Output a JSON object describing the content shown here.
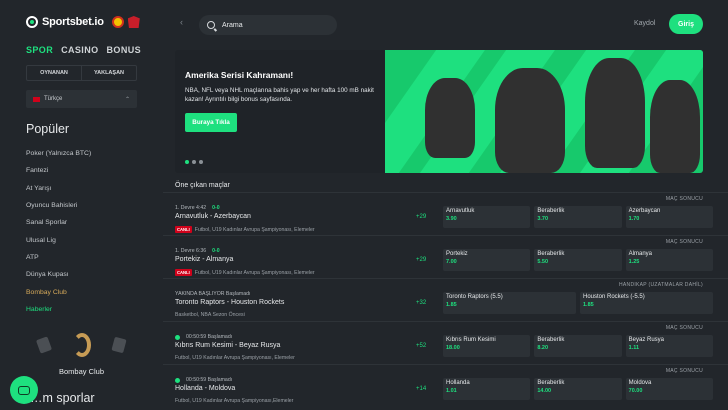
{
  "brand": {
    "name": "Sportsbet.io"
  },
  "sidebar": {
    "modes": [
      "SPOR",
      "CASINO",
      "BONUS"
    ],
    "subtabs": [
      "OYNANAN",
      "YAKLAŞAN"
    ],
    "language": "Türkçe",
    "popular_title": "Popüler",
    "items": [
      "Poker (Yalnızca BTC)",
      "Fantezi",
      "At Yarışı",
      "Oyuncu Bahisleri",
      "Sanal Sporlar",
      "Ulusal Lig",
      "ATP",
      "Dünya Kupası",
      "Bombay Club",
      "Haberler"
    ],
    "club_label": "Bombay Club",
    "bottom_title": "…m sporlar"
  },
  "header": {
    "back_glyph": "‹",
    "search_value": "Arama",
    "register_label": "Kaydol",
    "login_label": "Giriş"
  },
  "banner": {
    "title": "Amerika Serisi Kahramanı!",
    "text": "NBA, NFL veya NHL maçlarına bahis yap ve her hafta 100 mB nakit kazan! Ayrıntılı bilgi bonus sayfasında.",
    "button_label": "Buraya Tıkla"
  },
  "featured_title": "Öne çıkan maçlar",
  "matches": [
    {
      "market_title": "MAÇ SONUCU",
      "status": "1. Devre   4:42",
      "score": "0-0",
      "teams": "Arnavutluk - Azerbaycan",
      "live_tag": "CANLI",
      "league": "Futbol, U19 Kadınlar Avrupa Şampiyonası, Elemeler",
      "count": "+29",
      "odds": [
        {
          "label": "Arnavutluk",
          "value": "3.90"
        },
        {
          "label": "Beraberlik",
          "value": "3.70"
        },
        {
          "label": "Azerbaycan",
          "value": "1.70"
        }
      ]
    },
    {
      "market_title": "MAÇ SONUCU",
      "status": "1. Devre   6:36",
      "score": "0-0",
      "teams": "Portekiz - Almanya",
      "live_tag": "CANLI",
      "league": "Futbol, U19 Kadınlar Avrupa Şampiyonası, Elemeler",
      "count": "+29",
      "odds": [
        {
          "label": "Portekiz",
          "value": "7.00"
        },
        {
          "label": "Beraberlik",
          "value": "5.50"
        },
        {
          "label": "Almanya",
          "value": "1.25"
        }
      ]
    },
    {
      "market_title": "HANDIKAP (UZATMALAR DAHİL)",
      "status": "YAKINDA BAŞLIYOR   Başlamadı",
      "score": "",
      "teams": "Toronto Raptors - Houston Rockets",
      "live_tag": "",
      "league": "Basketbol, NBA Sezon Öncesi",
      "count": "+32",
      "odds": [
        {
          "label": "Toronto Raptors (5.5)",
          "value": "1.85"
        },
        {
          "label": "Houston Rockets (-5.5)",
          "value": "1.85"
        }
      ]
    },
    {
      "market_title": "MAÇ SONUCU",
      "status": "00:50:59   Başlamadı",
      "score": "",
      "teams": "Kıbrıs Rum Kesimi - Beyaz Rusya",
      "live_tag": "",
      "league": "Futbol, U19 Kadınlar Avrupa Şampiyonası, Elemeler",
      "count": "+52",
      "odds": [
        {
          "label": "Kıbrıs Rum Kesimi",
          "value": "18.00"
        },
        {
          "label": "Beraberlik",
          "value": "8.20"
        },
        {
          "label": "Beyaz Rusya",
          "value": "1.11"
        }
      ]
    },
    {
      "market_title": "MAÇ SONUCU",
      "status": "00:50:59   Başlamadı",
      "score": "",
      "teams": "Hollanda - Moldova",
      "live_tag": "",
      "league": "Futbol, U19 Kadınlar Avrupa Şampiyonası,Elemeler",
      "count": "+14",
      "odds": [
        {
          "label": "Hollanda",
          "value": "1.01"
        },
        {
          "label": "Beraberlik",
          "value": "14.00"
        },
        {
          "label": "Moldova",
          "value": "70.00"
        }
      ]
    }
  ]
}
